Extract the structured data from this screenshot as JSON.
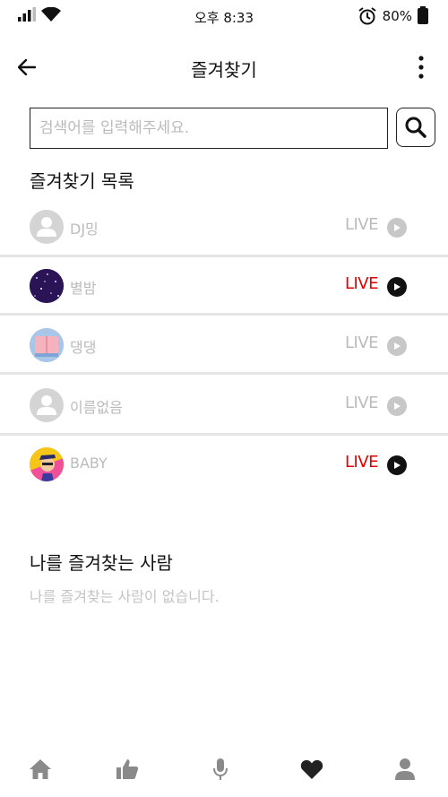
{
  "status_bar": {
    "time": "오후 8:33",
    "battery": "80%"
  },
  "header": {
    "title": "즐겨찾기"
  },
  "search": {
    "placeholder": "검색어를 입력해주세요."
  },
  "favorites_section": {
    "title": "즐겨찾기 목록",
    "items": [
      {
        "name": "DJ밍",
        "live_label": "LIVE",
        "is_live": false,
        "avatar": "default-user-icon"
      },
      {
        "name": "별밤",
        "live_label": "LIVE",
        "is_live": true,
        "avatar": "starry-night-image"
      },
      {
        "name": "댕댕",
        "live_label": "LIVE",
        "is_live": false,
        "avatar": "pink-box-image"
      },
      {
        "name": "이름없음",
        "live_label": "LIVE",
        "is_live": false,
        "avatar": "default-user-icon"
      },
      {
        "name": "BABY",
        "live_label": "LIVE",
        "is_live": true,
        "avatar": "cartoon-character-image"
      }
    ]
  },
  "followers_section": {
    "title": "나를 즐겨찾는 사람",
    "empty_text": "나를 즐겨찾는 사람이 없습니다."
  },
  "bottom_nav": {
    "items": [
      {
        "icon": "home-icon",
        "active": false
      },
      {
        "icon": "thumbs-up-icon",
        "active": false
      },
      {
        "icon": "microphone-icon",
        "active": false
      },
      {
        "icon": "heart-icon",
        "active": true
      },
      {
        "icon": "profile-icon",
        "active": false
      }
    ]
  },
  "colors": {
    "live_active": "#e00000",
    "inactive_gray": "#bbbbbb",
    "nav_inactive": "#8a8a8a",
    "nav_active": "#222222"
  }
}
